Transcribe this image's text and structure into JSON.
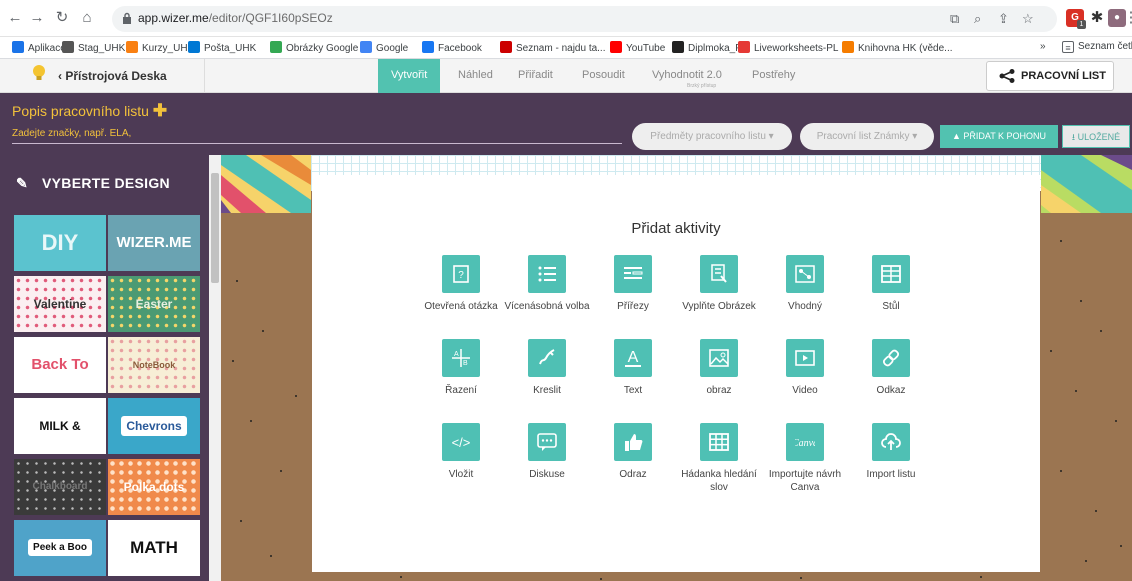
{
  "browser": {
    "url_domain": "app.wizer.me",
    "url_path": "/editor/QGF1I60pSEOz",
    "ext_badge": "1",
    "bookmarks": [
      {
        "label": "Aplikace",
        "icon": "apps-icon",
        "color": "#1a73e8"
      },
      {
        "label": "Stag_UHK",
        "icon": "stag-icon",
        "color": "#555555"
      },
      {
        "label": "Kurzy_UHK",
        "icon": "moodle-icon",
        "color": "#f98012"
      },
      {
        "label": "Pošta_UHK",
        "icon": "mail-icon",
        "color": "#0078d4"
      },
      {
        "label": "Obrázky Google",
        "icon": "google-icon",
        "color": "#34a853"
      },
      {
        "label": "Google",
        "icon": "google-icon",
        "color": "#4285f4"
      },
      {
        "label": "Facebook",
        "icon": "facebook-icon",
        "color": "#1877f2"
      },
      {
        "label": "Seznam - najdu ta...",
        "icon": "seznam-icon",
        "color": "#cc0000"
      },
      {
        "label": "YouTube",
        "icon": "youtube-icon",
        "color": "#ff0000"
      },
      {
        "label": "Diplmoka_PL",
        "icon": "pen-icon",
        "color": "#222222"
      },
      {
        "label": "Liveworksheets-PL",
        "icon": "liveworksheets-icon",
        "color": "#e53935"
      },
      {
        "label": "Knihovna HK (věde...",
        "icon": "library-icon",
        "color": "#f57c00"
      }
    ],
    "bookmarks_more": "»",
    "reading_list": "Seznam četby"
  },
  "app_nav": {
    "back_label": "Přístrojová Deska",
    "tabs": [
      {
        "label": "Vytvořit",
        "active": true
      },
      {
        "label": "Náhled",
        "active": false
      },
      {
        "label": "Přiřadit",
        "active": false
      },
      {
        "label": "Posoudit",
        "active": false
      },
      {
        "label": "Vyhodnotit 2.0",
        "active": false,
        "sub": "Brzký přístup"
      },
      {
        "label": "Postřehy",
        "active": false
      }
    ],
    "worksheet_button": "PRACOVNÍ LIST"
  },
  "header": {
    "title": "Popis pracovního listu",
    "tags_placeholder": "Zadejte značky, např. ELA,",
    "subjects_dropdown": "Předměty pracovního listu",
    "grades_dropdown": "Pracovní list Známky",
    "drive_button": "PŘIDAT K POHONU",
    "saved_button": "ULOŽENÉ"
  },
  "sidebar": {
    "title": "VYBERTE DESIGN",
    "designs": [
      {
        "label": "DIY"
      },
      {
        "label": "WIZER.ME"
      },
      {
        "label": "Valentine"
      },
      {
        "label": "Easter"
      },
      {
        "label": "Back To School"
      },
      {
        "label": "NoteBook"
      },
      {
        "label": "MILK & COOKIES"
      },
      {
        "label": "Chevrons"
      },
      {
        "label": "Chalkboard"
      },
      {
        "label": "Polka dots"
      },
      {
        "label": "Peek a Boo"
      },
      {
        "label": "MATH"
      }
    ]
  },
  "card": {
    "title": "Přidat aktivity",
    "activities": [
      {
        "label": "Otevřená otázka",
        "icon": "open-question-icon"
      },
      {
        "label": "Vícenásobná volba",
        "icon": "multiple-choice-icon"
      },
      {
        "label": "Přířezy",
        "icon": "blanks-icon"
      },
      {
        "label": "Vyplňte Obrázek",
        "icon": "fill-image-icon"
      },
      {
        "label": "Vhodný",
        "icon": "matching-icon"
      },
      {
        "label": "Stůl",
        "icon": "table-icon"
      },
      {
        "label": "Řazení",
        "icon": "sorting-icon"
      },
      {
        "label": "Kreslit",
        "icon": "draw-icon"
      },
      {
        "label": "Text",
        "icon": "text-icon"
      },
      {
        "label": "obraz",
        "icon": "image-icon"
      },
      {
        "label": "Video",
        "icon": "video-icon"
      },
      {
        "label": "Odkaz",
        "icon": "link-icon"
      },
      {
        "label": "Vložit",
        "icon": "embed-icon"
      },
      {
        "label": "Diskuse",
        "icon": "discussion-icon"
      },
      {
        "label": "Odraz",
        "icon": "reflection-icon"
      },
      {
        "label": "Hádanka hledání slov",
        "icon": "word-search-icon"
      },
      {
        "label": "Importujte návrh Canva",
        "icon": "canva-icon"
      },
      {
        "label": "Import listu",
        "icon": "import-icon"
      }
    ]
  },
  "colors": {
    "accent": "#52c2b0",
    "purple": "#4d3a55",
    "gold": "#f2c13b"
  }
}
